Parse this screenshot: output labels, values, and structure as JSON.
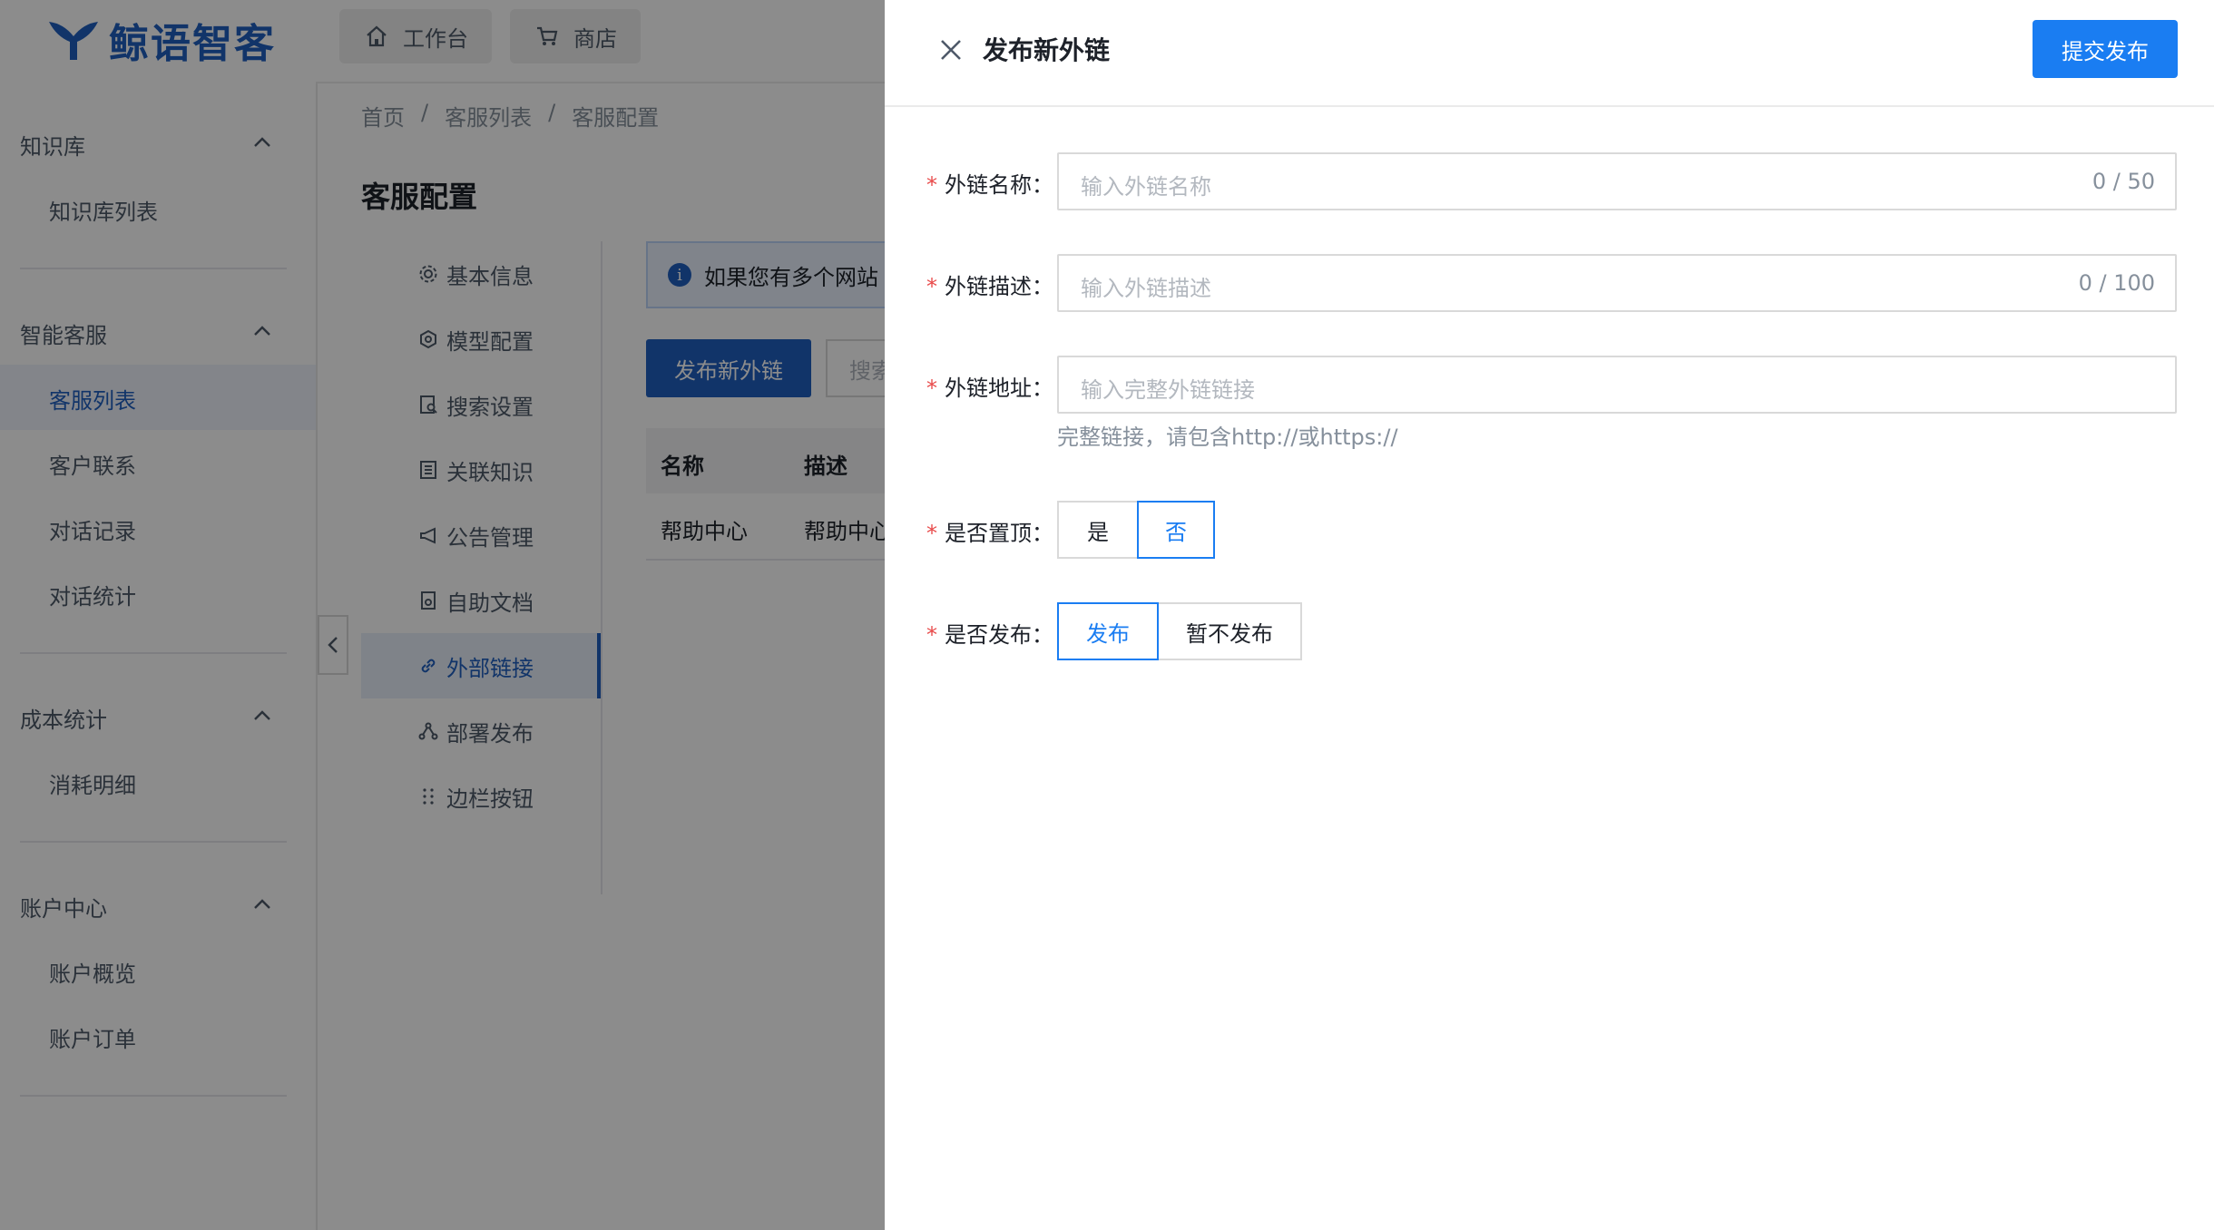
{
  "brand": {
    "name": "鲸语智客",
    "color": "#1f5fbf"
  },
  "topbar": {
    "buttons": [
      {
        "label": "工作台",
        "icon": "home-icon"
      },
      {
        "label": "商店",
        "icon": "cart-icon"
      }
    ]
  },
  "sidebar": {
    "groups": [
      {
        "title": "知识库",
        "items": [
          "知识库列表"
        ]
      },
      {
        "title": "智能客服",
        "items": [
          "客服列表",
          "客户联系",
          "对话记录",
          "对话统计"
        ]
      },
      {
        "title": "成本统计",
        "items": [
          "消耗明细"
        ]
      },
      {
        "title": "账户中心",
        "items": [
          "账户概览",
          "账户订单"
        ]
      }
    ],
    "active_item": "客服列表"
  },
  "breadcrumb": [
    "首页",
    "客服列表",
    "客服配置"
  ],
  "breadcrumb_sep": "/",
  "page_title": "客服配置",
  "config_menu": {
    "items": [
      {
        "label": "基本信息",
        "icon": "gear-icon"
      },
      {
        "label": "模型配置",
        "icon": "model-icon"
      },
      {
        "label": "搜索设置",
        "icon": "search-doc-icon"
      },
      {
        "label": "关联知识",
        "icon": "book-icon"
      },
      {
        "label": "公告管理",
        "icon": "megaphone-icon"
      },
      {
        "label": "自助文档",
        "icon": "document-icon"
      },
      {
        "label": "外部链接",
        "icon": "link-icon"
      },
      {
        "label": "部署发布",
        "icon": "deploy-icon"
      },
      {
        "label": "边栏按钮",
        "icon": "grip-icon"
      }
    ],
    "active": "外部链接"
  },
  "content": {
    "info_text": "如果您有多个网站",
    "publish_button": "发布新外链",
    "search_placeholder": "搜索",
    "table": {
      "columns": [
        "名称",
        "描述"
      ],
      "rows": [
        [
          "帮助中心",
          "帮助中心"
        ]
      ]
    }
  },
  "drawer": {
    "title": "发布新外链",
    "submit": "提交发布",
    "fields": {
      "name": {
        "label": "外链名称：",
        "placeholder": "输入外链名称",
        "counter": "0 / 50"
      },
      "desc": {
        "label": "外链描述：",
        "placeholder": "输入外链描述",
        "counter": "0 / 100"
      },
      "url": {
        "label": "外链地址：",
        "placeholder": "输入完整外链链接",
        "hint": "完整链接，请包含http://或https://"
      },
      "pin": {
        "label": "是否置顶：",
        "options": [
          "是",
          "否"
        ],
        "selected": "否"
      },
      "publish": {
        "label": "是否发布：",
        "options": [
          "发布",
          "暂不发布"
        ],
        "selected": "发布"
      }
    },
    "required_mark": "*",
    "accent": "#1a7df2"
  }
}
